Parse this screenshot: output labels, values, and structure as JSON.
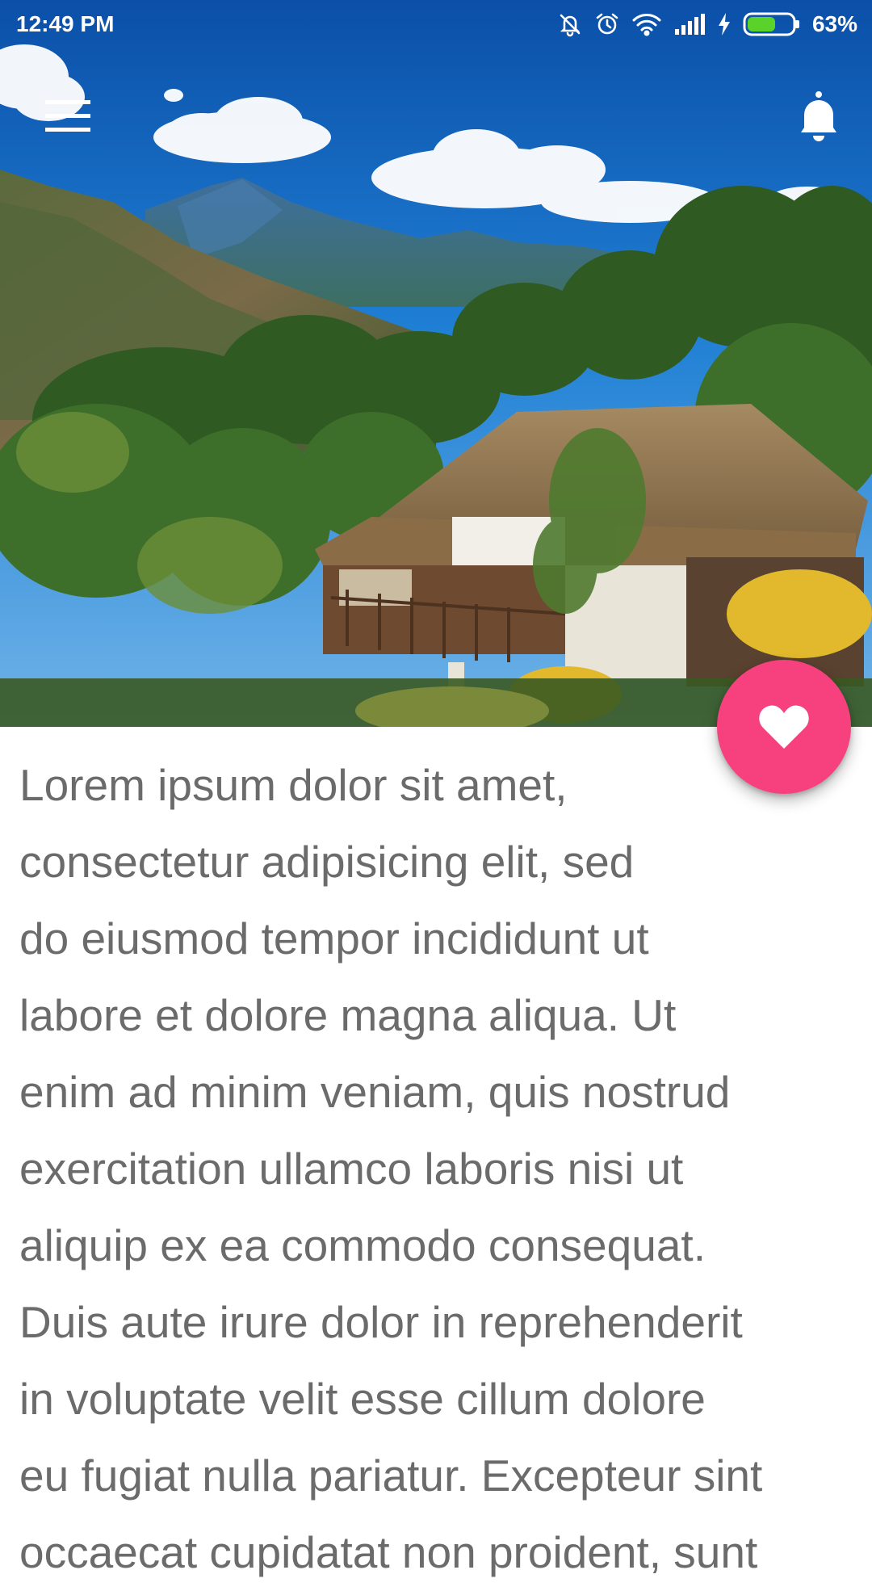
{
  "status_bar": {
    "time": "12:49 PM",
    "battery_percent": "63%",
    "battery_level": 0.63,
    "icons": [
      "mute-icon",
      "alarm-icon",
      "wifi-icon",
      "signal-icon",
      "charging-icon",
      "battery-icon"
    ]
  },
  "toolbar": {
    "menu_icon": "hamburger-menu-icon",
    "notification_icon": "bell-icon"
  },
  "header_image": {
    "subject": "thatched-roof house on a hillside with mountains and blue sky"
  },
  "fab": {
    "icon": "heart-icon",
    "color": "#f7417e"
  },
  "article": {
    "lines": [
      "Lorem ipsum dolor sit amet,",
      "consectetur adipisicing elit, sed",
      "do eiusmod tempor incididunt ut",
      "labore et dolore magna aliqua. Ut",
      "enim ad minim veniam, quis nostrud",
      "exercitation ullamco laboris nisi ut",
      "aliquip ex ea commodo consequat.",
      "Duis aute irure dolor in reprehenderit",
      "in voluptate velit esse cillum dolore",
      "eu fugiat nulla pariatur. Excepteur sint",
      "occaecat cupidatat non proident, sunt"
    ],
    "text_color": "#6b6b6b"
  }
}
